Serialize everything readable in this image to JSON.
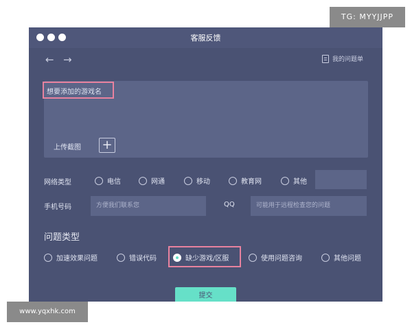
{
  "window": {
    "title": "客服反馈"
  },
  "nav": {
    "back_icon": "←",
    "forward_icon": "→",
    "my_issues_label": "我的问题单"
  },
  "feedback": {
    "game_name_placeholder": "想要添加的游戏名",
    "upload_label": "上传截图",
    "add_icon": "+"
  },
  "network": {
    "label": "网络类型",
    "options": [
      "电信",
      "网通",
      "移动",
      "教育网",
      "其他"
    ]
  },
  "contact": {
    "phone_label": "手机号码",
    "phone_placeholder": "方便我们联系您",
    "qq_label": "QQ",
    "qq_placeholder": "可能用于远程检查您的问题"
  },
  "issue_type": {
    "label": "问题类型",
    "options": [
      "加速效果问题",
      "错误代码",
      "缺少游戏/区服",
      "使用问题咨询",
      "其他问题"
    ],
    "selected": "缺少游戏/区服"
  },
  "submit_label": "提交",
  "watermarks": {
    "top": "TG: MYYJJPP",
    "bottom": "www.yqxhk.com"
  },
  "colors": {
    "window_bg": "#4a5273",
    "accent": "#66e0c8",
    "highlight": "#e8829f"
  }
}
